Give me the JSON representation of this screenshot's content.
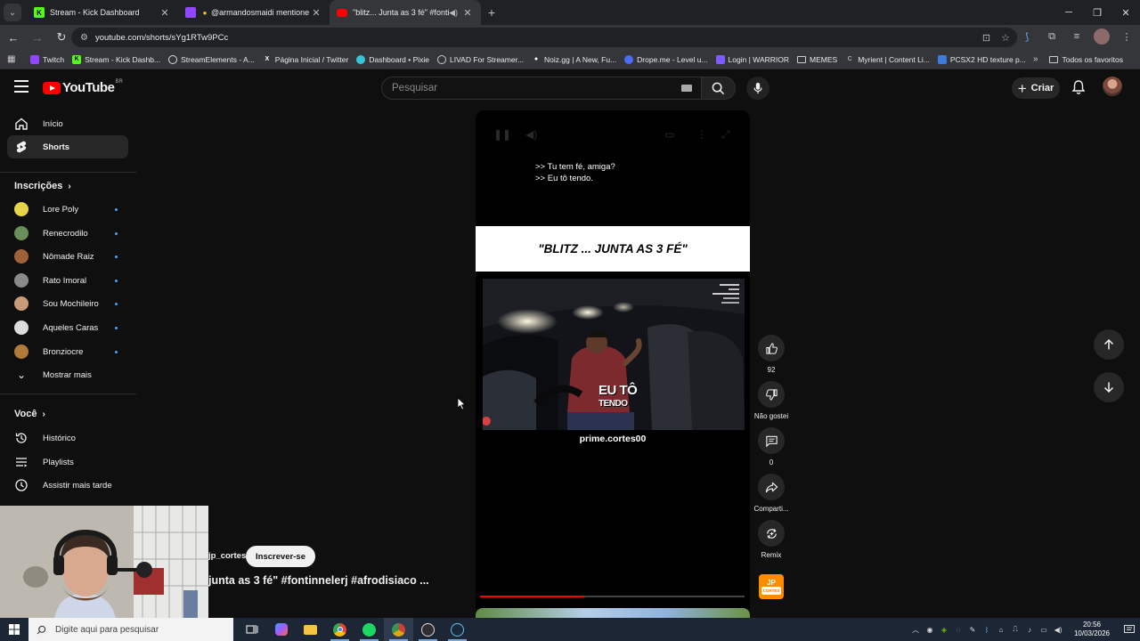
{
  "browser": {
    "tabs": [
      {
        "title": "Stream - Kick Dashboard",
        "favicon": "K",
        "color": "#53fc18",
        "active": false
      },
      {
        "title": "@armandosmaidi mentione",
        "favicon": "",
        "color": "#9146ff",
        "active": false
      },
      {
        "title": "\"blitz... Junta as 3 fé\" #fonti",
        "favicon": "",
        "color": "#ff0000",
        "active": true
      }
    ],
    "url": "youtube.com/shorts/sYg1RTw9PCc",
    "bookmarks": [
      {
        "label": "Twitch",
        "icon_color": "#9146ff"
      },
      {
        "label": "Stream - Kick Dashb...",
        "icon_color": "#53fc18"
      },
      {
        "label": "StreamElements - A...",
        "icon_color": "#dddddd"
      },
      {
        "label": "Página Inicial / Twitter",
        "icon_color": "#000000"
      },
      {
        "label": "Dashboard • Pixie",
        "icon_color": "#36c5d9"
      },
      {
        "label": "LIVAD For Streamer...",
        "icon_color": "#cccccc"
      },
      {
        "label": "Noiz.gg | A New, Fu...",
        "icon_color": "#ffffff"
      },
      {
        "label": "Drope.me - Level u...",
        "icon_color": "#4a6cf7"
      },
      {
        "label": "Login | WARRIOR",
        "icon_color": "#7b5cff"
      },
      {
        "label": "MEMES",
        "icon_color": "folder"
      },
      {
        "label": "Myrient | Content Li...",
        "icon_color": "#888888"
      },
      {
        "label": "PCSX2 HD texture p...",
        "icon_color": "#3d7be0"
      }
    ],
    "all_bookmarks": "Todos os favoritos"
  },
  "youtube": {
    "logo_text": "YouTube",
    "country_code": "BR",
    "search_placeholder": "Pesquisar",
    "create_label": "Criar",
    "sidebar": {
      "home": "Início",
      "shorts": "Shorts",
      "subscriptions_heading": "Inscrições",
      "subscriptions": [
        {
          "name": "Lore Poly",
          "avatar_color": "#e6d44a"
        },
        {
          "name": "Renecrodilo",
          "avatar_color": "#6a8f5a"
        },
        {
          "name": "Nômade Raiz",
          "avatar_color": "#a0603a"
        },
        {
          "name": "Rato Imoral",
          "avatar_color": "#8a8a8a"
        },
        {
          "name": "Sou Mochileiro",
          "avatar_color": "#c89a78"
        },
        {
          "name": "Aqueles Caras",
          "avatar_color": "#dddddd"
        },
        {
          "name": "Bronziocre",
          "avatar_color": "#b07a3a"
        }
      ],
      "show_more": "Mostrar mais",
      "you_heading": "Você",
      "history": "Histórico",
      "playlists": "Playlists",
      "watch_later": "Assistir mais tarde"
    },
    "short": {
      "caption_lines": [
        ">> Tu tem fé, amiga?",
        ">> Eu tô tendo."
      ],
      "banner_text": "\"BLITZ ... JUNTA AS 3 FÉ\"",
      "overlay_line1": "EU TÔ",
      "overlay_line2": "TENDO",
      "handle": "prime.cortes00",
      "progress": 0.39,
      "channel": "jp_cortes",
      "subscribe_label": "Inscrever-se",
      "title": "junta as 3 fé\" #fontinnelerj #afrodisiaco ..."
    },
    "actions": {
      "likes": "92",
      "dislike_label": "Não gostei",
      "comments": "0",
      "share_label": "Comparti...",
      "remix_label": "Remix",
      "channel_avatar_text": "JP",
      "channel_avatar_sub": "CORTES"
    }
  },
  "taskbar": {
    "search_placeholder": "Digite aqui para pesquisar",
    "time": "20:56",
    "date": "10/03/2026"
  }
}
